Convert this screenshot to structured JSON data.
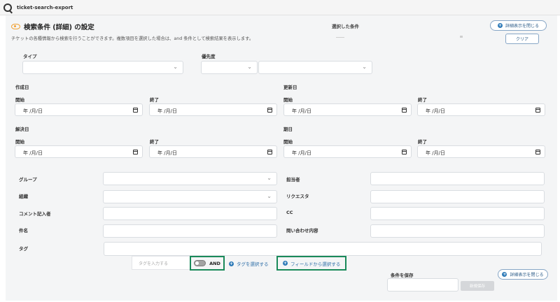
{
  "app": {
    "title": "ticket-search-export"
  },
  "panel": {
    "heading": "検索条件 (詳細) の設定",
    "description": "チケットの各種情報から検索を行うことができます。複数項目を選択した場合は、and 条件として検索結果を表示します。",
    "selected_conditions_label": "選択した条件",
    "collapse_button": "詳細表示を閉じる",
    "clear_button": "クリア"
  },
  "filters": {
    "type_label": "タイプ",
    "priority_label": "優先度"
  },
  "dates": {
    "created_label": "作成日",
    "updated_label": "更新日",
    "resolved_label": "解決日",
    "due_label": "期日",
    "start_label": "開始",
    "end_label": "終了",
    "placeholder": "年 /月/日"
  },
  "fields": {
    "group_label": "グループ",
    "organization_label": "組織",
    "commenter_label": "コメント記入者",
    "subject_label": "件名",
    "tag_label": "タグ",
    "assignee_label": "担当者",
    "requester_label": "リクエスタ",
    "cc_label": "CC",
    "inquiry_label": "問い合わせ内容"
  },
  "tags": {
    "input_placeholder": "タグを入力する",
    "and_label": "AND",
    "select_tags_link": "タグを選択する",
    "select_from_field_link": "フィールドから選択する"
  },
  "save": {
    "label": "条件を保存",
    "button": "新規保存",
    "collapse_button": "詳細表示を閉じる"
  }
}
